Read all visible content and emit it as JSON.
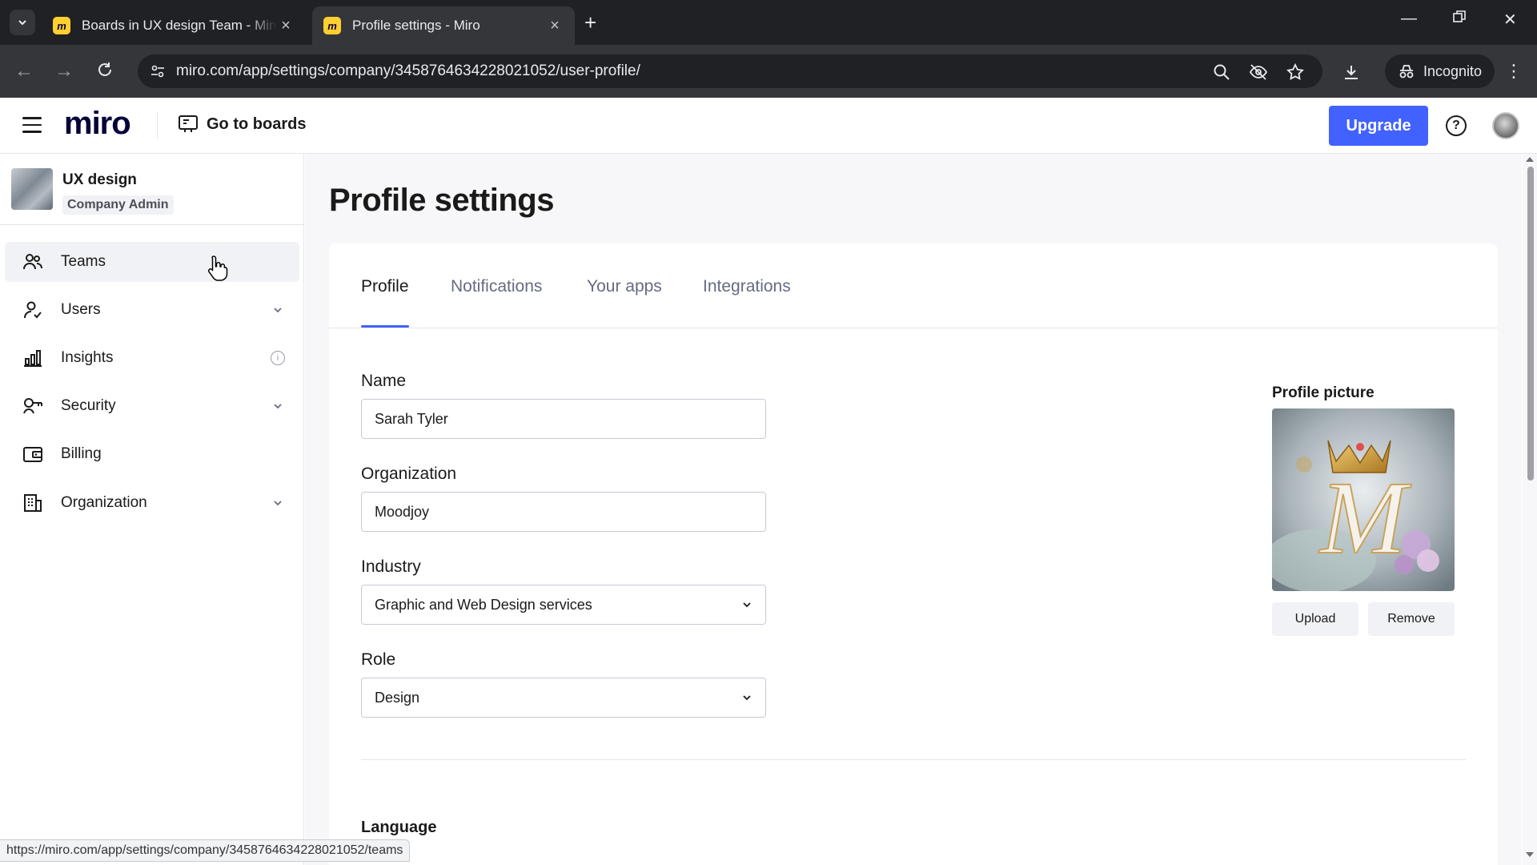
{
  "browser": {
    "tabs": [
      {
        "title": "Boards in UX design Team - Miro",
        "active": false
      },
      {
        "title": "Profile settings - Miro",
        "active": true
      }
    ],
    "url": "miro.com/app/settings/company/3458764634228021052/user-profile/",
    "incognito_label": "Incognito",
    "status_url": "https://miro.com/app/settings/company/3458764634228021052/teams"
  },
  "header": {
    "logo": "miro",
    "go_to_boards": "Go to boards",
    "upgrade": "Upgrade",
    "help_glyph": "?"
  },
  "sidebar": {
    "org_name": "UX design",
    "org_role": "Company Admin",
    "items": [
      {
        "label": "Teams",
        "icon": "teams-icon"
      },
      {
        "label": "Users",
        "icon": "users-icon"
      },
      {
        "label": "Insights",
        "icon": "insights-icon"
      },
      {
        "label": "Security",
        "icon": "security-icon"
      },
      {
        "label": "Billing",
        "icon": "billing-icon"
      },
      {
        "label": "Organization",
        "icon": "organization-icon"
      }
    ]
  },
  "page": {
    "title": "Profile settings",
    "tabs": [
      "Profile",
      "Notifications",
      "Your apps",
      "Integrations"
    ],
    "fields": {
      "name_label": "Name",
      "name_value": "Sarah Tyler",
      "org_label": "Organization",
      "org_value": "Moodjoy",
      "industry_label": "Industry",
      "industry_value": "Graphic and Web Design services",
      "role_label": "Role",
      "role_value": "Design"
    },
    "profile_picture": {
      "label": "Profile picture",
      "upload": "Upload",
      "remove": "Remove"
    },
    "language_label": "Language"
  },
  "colors": {
    "accent": "#4262ff",
    "tab_underline": "#4262ff",
    "miro_yellow": "#ffd02f"
  }
}
